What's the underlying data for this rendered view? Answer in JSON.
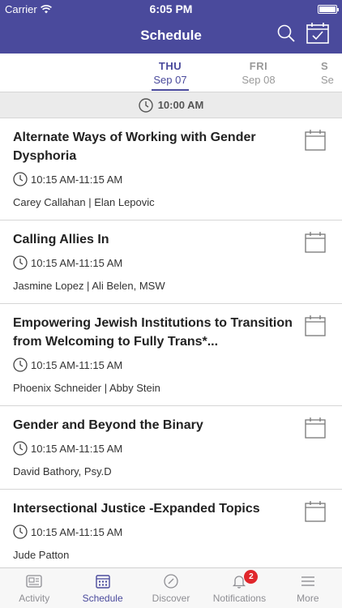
{
  "status": {
    "carrier": "Carrier",
    "time": "6:05 PM"
  },
  "navbar": {
    "title": "Schedule"
  },
  "days": [
    {
      "dow": "THU",
      "date": "Sep 07",
      "active": true
    },
    {
      "dow": "FRI",
      "date": "Sep 08",
      "active": false
    },
    {
      "dow": "S",
      "date": "Se",
      "active": false
    }
  ],
  "time_header": "10:00 AM",
  "sessions": [
    {
      "title": "Alternate Ways of Working with Gender Dysphoria",
      "time": "10:15 AM-11:15 AM",
      "speakers": "Carey Callahan | Elan Lepovic"
    },
    {
      "title": "Calling Allies In",
      "time": "10:15 AM-11:15 AM",
      "speakers": "Jasmine Lopez | Ali Belen, MSW"
    },
    {
      "title": "Empowering Jewish Institutions to Transition from Welcoming to Fully Trans*...",
      "time": "10:15 AM-11:15 AM",
      "speakers": "Phoenix Schneider | Abby Stein"
    },
    {
      "title": "Gender and Beyond the Binary",
      "time": "10:15 AM-11:15 AM",
      "speakers": "David Bathory, Psy.D"
    },
    {
      "title": "Intersectional Justice -Expanded Topics",
      "time": "10:15 AM-11:15 AM",
      "speakers": "Jude Patton"
    }
  ],
  "tabs": [
    {
      "label": "Activity",
      "icon": "activity-icon"
    },
    {
      "label": "Schedule",
      "icon": "schedule-icon"
    },
    {
      "label": "Discover",
      "icon": "compass-icon"
    },
    {
      "label": "Notifications",
      "icon": "bell-icon",
      "badge": "2"
    },
    {
      "label": "More",
      "icon": "menu-icon"
    }
  ],
  "colors": {
    "brand": "#4a4a9c",
    "badge": "#e0262b"
  }
}
